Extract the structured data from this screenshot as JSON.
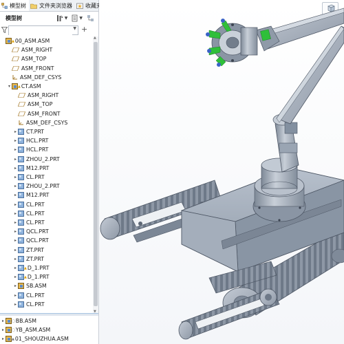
{
  "tabs": [
    {
      "label": "模型树",
      "icon": "model-tree-icon"
    },
    {
      "label": "文件夹浏览器",
      "icon": "folder-icon"
    },
    {
      "label": "收藏夹",
      "icon": "favorites-icon"
    }
  ],
  "toolbar": {
    "title": "模型树",
    "buttons": [
      "tree-settings-icon",
      "dropdown-icon",
      "show-icon",
      "dropdown-icon",
      "tree-columns-icon"
    ]
  },
  "filter": {
    "value": "",
    "placeholder": ""
  },
  "tree": {
    "items": [
      {
        "label": "00_ASM.ASM",
        "type": "asm",
        "indent": 0,
        "arrow": "",
        "flag": "▲"
      },
      {
        "label": "ASM_RIGHT",
        "type": "plane",
        "indent": 1,
        "arrow": ""
      },
      {
        "label": "ASM_TOP",
        "type": "plane",
        "indent": 1,
        "arrow": ""
      },
      {
        "label": "ASM_FRONT",
        "type": "plane",
        "indent": 1,
        "arrow": ""
      },
      {
        "label": "ASM_DEF_CSYS",
        "type": "csys",
        "indent": 1,
        "arrow": ""
      },
      {
        "label": "CT.ASM",
        "type": "asm",
        "indent": 1,
        "arrow": "▾",
        "flag": "▲"
      },
      {
        "label": "ASM_RIGHT",
        "type": "plane",
        "indent": 2,
        "arrow": ""
      },
      {
        "label": "ASM_TOP",
        "type": "plane",
        "indent": 2,
        "arrow": ""
      },
      {
        "label": "ASM_FRONT",
        "type": "plane",
        "indent": 2,
        "arrow": ""
      },
      {
        "label": "ASM_DEF_CSYS",
        "type": "csys",
        "indent": 2,
        "arrow": ""
      },
      {
        "label": "CT.PRT",
        "type": "prt",
        "indent": 2,
        "arrow": "▸"
      },
      {
        "label": "HCL.PRT",
        "type": "prt",
        "indent": 2,
        "arrow": "▸"
      },
      {
        "label": "HCL.PRT",
        "type": "prt",
        "indent": 2,
        "arrow": "▸"
      },
      {
        "label": "ZHOU_2.PRT",
        "type": "prt",
        "indent": 2,
        "arrow": "▸"
      },
      {
        "label": "M12.PRT",
        "type": "prt",
        "indent": 2,
        "arrow": "▸"
      },
      {
        "label": "CL.PRT",
        "type": "prt",
        "indent": 2,
        "arrow": "▸"
      },
      {
        "label": "ZHOU_2.PRT",
        "type": "prt",
        "indent": 2,
        "arrow": "▸"
      },
      {
        "label": "M12.PRT",
        "type": "prt",
        "indent": 2,
        "arrow": "▸"
      },
      {
        "label": "CL.PRT",
        "type": "prt",
        "indent": 2,
        "arrow": "▸"
      },
      {
        "label": "CL.PRT",
        "type": "prt",
        "indent": 2,
        "arrow": "▸"
      },
      {
        "label": "CL.PRT",
        "type": "prt",
        "indent": 2,
        "arrow": "▸"
      },
      {
        "label": "QCL.PRT",
        "type": "prt",
        "indent": 2,
        "arrow": "▸"
      },
      {
        "label": "QCL.PRT",
        "type": "prt",
        "indent": 2,
        "arrow": "▸"
      },
      {
        "label": "ZT.PRT",
        "type": "prt",
        "indent": 2,
        "arrow": "▸"
      },
      {
        "label": "ZT.PRT",
        "type": "prt",
        "indent": 2,
        "arrow": "▸"
      },
      {
        "label": "D_1.PRT",
        "type": "prt",
        "indent": 2,
        "arrow": "▸",
        "flag": "▲"
      },
      {
        "label": "D_1.PRT",
        "type": "prt",
        "indent": 2,
        "arrow": "▸",
        "flag": "▲"
      },
      {
        "label": "SB.ASM",
        "type": "asm",
        "indent": 2,
        "arrow": "▸"
      },
      {
        "label": "CL.PRT",
        "type": "prt",
        "indent": 2,
        "arrow": "▸"
      },
      {
        "label": "CL.PRT",
        "type": "prt",
        "indent": 2,
        "arrow": "▸"
      }
    ],
    "bottom_items": [
      {
        "label": "BB.ASM",
        "type": "asm",
        "arrow": "▸",
        "flag": "▢"
      },
      {
        "label": "YB_ASM.ASM",
        "type": "asm",
        "arrow": "▸",
        "flag": "▢"
      },
      {
        "label": "01_SHOUZHUA.ASM",
        "type": "asm",
        "arrow": "▸",
        "flag": "▲"
      }
    ]
  },
  "colors": {
    "part_body": "#9fa9b8",
    "part_dark": "#6f7b8c",
    "highlight_green": "#2fbf3a",
    "tree_selection": "#cfe3f7"
  }
}
